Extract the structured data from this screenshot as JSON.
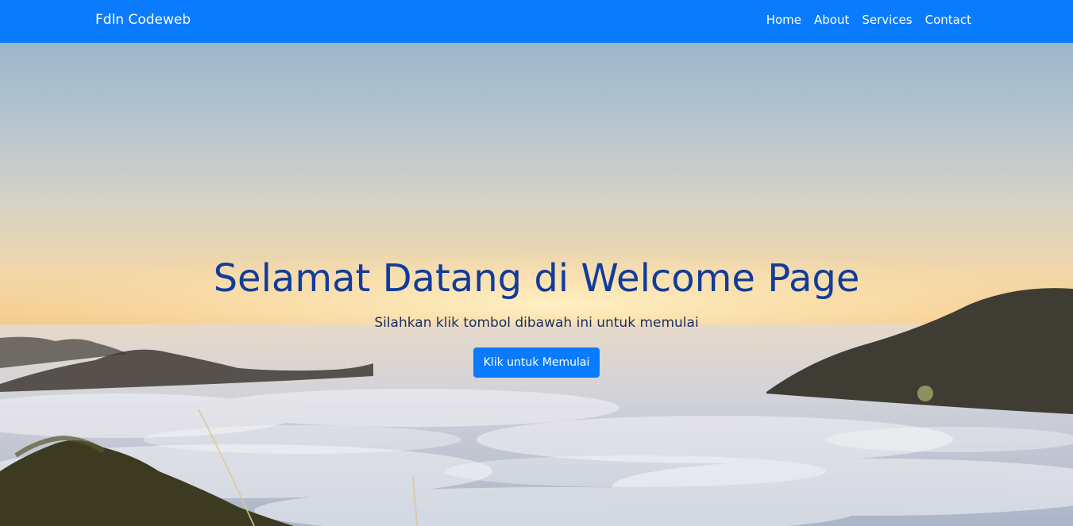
{
  "navbar": {
    "brand": "Fdln Codeweb",
    "links": [
      "Home",
      "About",
      "Services",
      "Contact"
    ],
    "background_color": "#0a7bfc"
  },
  "hero": {
    "title": "Selamat Datang di Welcome Page",
    "subtitle": "Silahkan klik tombol dibawah ini untuk memulai",
    "button_label": "Klik untuk Memulai",
    "title_color": "#123c9a",
    "button_color": "#0a7bfc",
    "background_image": "sunrise-over-sea-of-clouds"
  }
}
